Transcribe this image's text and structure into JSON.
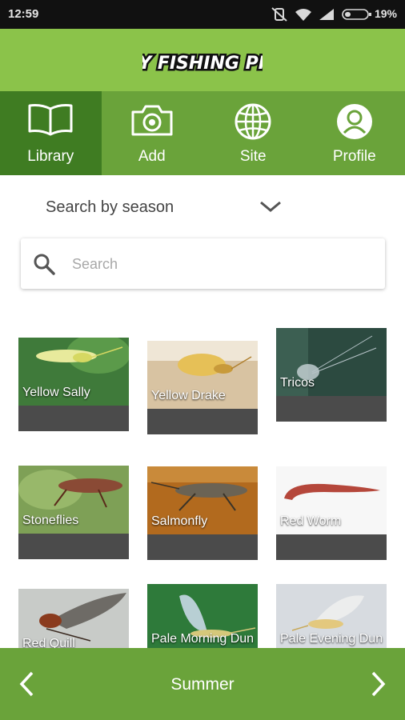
{
  "status_bar": {
    "time": "12:59",
    "battery_percent": "19%"
  },
  "header": {
    "logo_text": "FLY FISHING PRO"
  },
  "tabs": [
    {
      "label": "Library",
      "icon": "book-icon",
      "active": true
    },
    {
      "label": "Add",
      "icon": "camera-icon",
      "active": false
    },
    {
      "label": "Site",
      "icon": "globe-icon",
      "active": false
    },
    {
      "label": "Profile",
      "icon": "user-icon",
      "active": false
    }
  ],
  "season_filter": {
    "label": "Search by season"
  },
  "search": {
    "placeholder": "Search"
  },
  "insects": [
    {
      "name": "Yellow Sally"
    },
    {
      "name": "Yellow Drake"
    },
    {
      "name": "Tricos"
    },
    {
      "name": "Stoneflies"
    },
    {
      "name": "Salmonfly"
    },
    {
      "name": "Red Worm"
    },
    {
      "name": "Red Quill"
    },
    {
      "name": "Pale Morning Dun"
    },
    {
      "name": "Pale Evening Dun"
    }
  ],
  "bottom_bar": {
    "season": "Summer"
  },
  "colors": {
    "header_green": "#8bc34a",
    "tab_green": "#6aa33a",
    "tab_active_green": "#3f7c22"
  }
}
